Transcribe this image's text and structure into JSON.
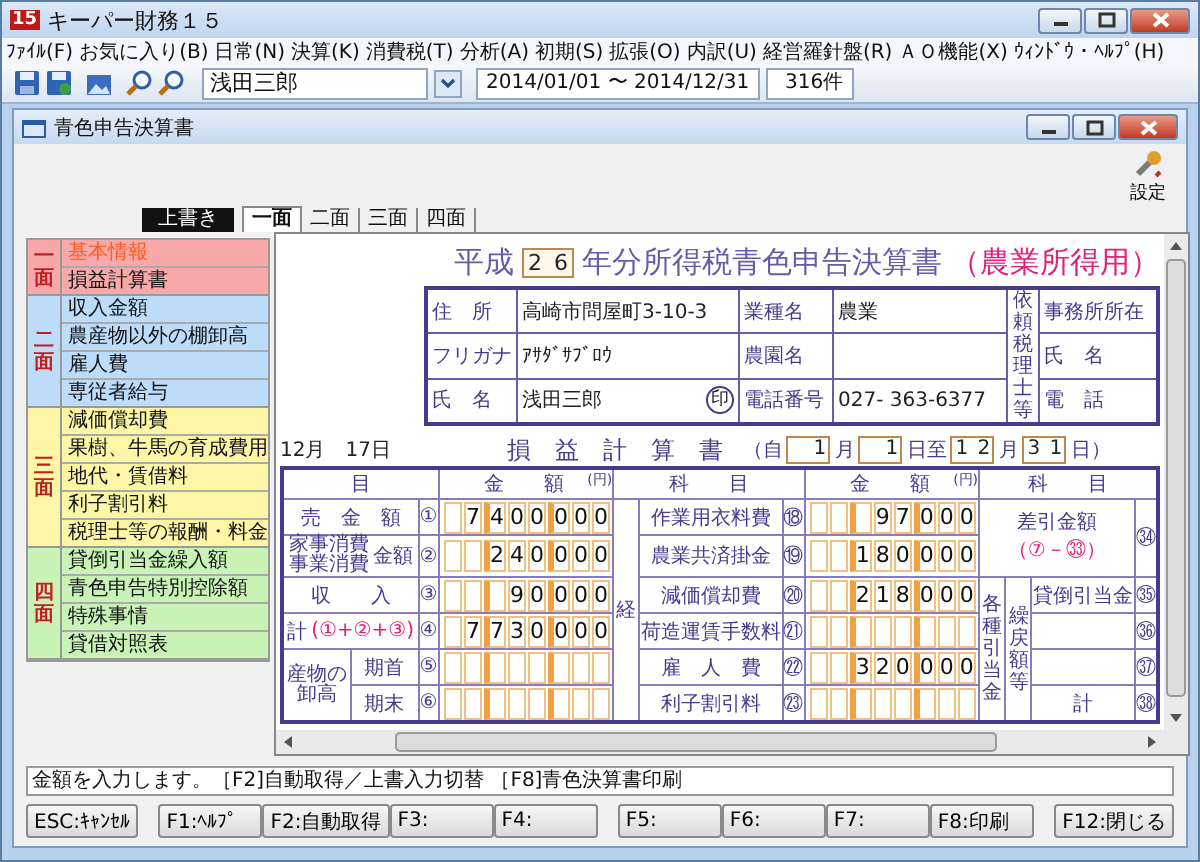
{
  "app": {
    "logo": "15",
    "title": "キーパー財務１５"
  },
  "menu": [
    "ﾌｧｲﾙ(F)",
    "お気に入り(B)",
    "日常(N)",
    "決算(K)",
    "消費税(T)",
    "分析(A)",
    "初期(S)",
    "拡張(O)",
    "内訳(U)",
    "経営羅針盤(R)",
    "ＡＯ機能(X)",
    "ｳｨﾝﾄﾞｳ・ﾍﾙﾌﾟ(H)"
  ],
  "toolbar": {
    "name": "浅田三郎",
    "period": "2014/01/01 〜 2014/12/31",
    "count": "316件"
  },
  "document": {
    "title": "青色申告決算書",
    "settings_label": "設定",
    "mode": "上書き",
    "tabs": [
      {
        "label": "一面",
        "selected": true
      },
      {
        "label": "二面",
        "selected": false
      },
      {
        "label": "三面",
        "selected": false
      },
      {
        "label": "四面",
        "selected": false
      }
    ],
    "nav": [
      {
        "label": "一面",
        "color": "#f7a8a8",
        "items": [
          {
            "label": "基本情報",
            "selected": true
          },
          {
            "label": "損益計算書",
            "selected": false
          }
        ]
      },
      {
        "label": "二面",
        "color": "#bcdcfa",
        "items": [
          {
            "label": "収入金額",
            "selected": false
          },
          {
            "label": "農産物以外の棚卸高",
            "selected": false
          },
          {
            "label": "雇人費",
            "selected": false
          },
          {
            "label": "専従者給与",
            "selected": false
          }
        ]
      },
      {
        "label": "三面",
        "color": "#fdf6a6",
        "items": [
          {
            "label": "減価償却費",
            "selected": false
          },
          {
            "label": "果樹、牛馬の育成費用",
            "selected": false
          },
          {
            "label": "地代・賃借料",
            "selected": false
          },
          {
            "label": "利子割引料",
            "selected": false
          },
          {
            "label": "税理士等の報酬・料金",
            "selected": false
          }
        ]
      },
      {
        "label": "四面",
        "color": "#c8f2b6",
        "items": [
          {
            "label": "貸倒引当金繰入額",
            "selected": false
          },
          {
            "label": "青色申告特別控除額",
            "selected": false
          },
          {
            "label": "特殊事情",
            "selected": false
          },
          {
            "label": "貸借対照表",
            "selected": false
          }
        ]
      }
    ],
    "form": {
      "era": "平成",
      "year": [
        "2",
        "6"
      ],
      "title": "年分所得税青色申告決算書",
      "subtitle": "（農業所得用）",
      "info": {
        "address_label": "住　所",
        "address": "高崎市問屋町3-10-3",
        "kana_label": "フリガナ",
        "kana": "ｱｻﾀﾞｻﾌﾞﾛｳ",
        "name_label": "氏　名",
        "name": "浅田三郎",
        "seal": "印",
        "industry_label": "業種名",
        "industry": "農業",
        "farm_label": "農園名",
        "phone_label": "電話番号",
        "phone": "027- 363-6377",
        "accountant_label": "依頼税理士等",
        "accountant_fields": [
          "事務所所在",
          "氏　名",
          "電　話"
        ]
      },
      "date": "12月　17日",
      "ledger_title": "損　益　計　算　書",
      "period": [
        {
          "kind": "text",
          "text": "（自"
        },
        {
          "kind": "box",
          "digits": [
            "1"
          ]
        },
        {
          "kind": "text",
          "text": "月"
        },
        {
          "kind": "box",
          "digits": [
            "1"
          ]
        },
        {
          "kind": "text",
          "text": "日至"
        },
        {
          "kind": "box",
          "digits": [
            "1",
            "2"
          ]
        },
        {
          "kind": "text",
          "text": "月"
        },
        {
          "kind": "box",
          "digits": [
            "3",
            "1"
          ]
        },
        {
          "kind": "text",
          "text": "日）"
        }
      ],
      "headers": [
        {
          "kind": "item",
          "text": "目"
        },
        {
          "kind": "amount",
          "text": "金　　額",
          "unit": "(円)"
        },
        {
          "kind": "subject",
          "text": "科　　目"
        },
        {
          "kind": "amount",
          "text": "金　　額",
          "unit": "(円)"
        },
        {
          "kind": "subject",
          "text": "科　　目"
        }
      ],
      "left_rows": [
        {
          "kind": "plain",
          "label": "売　金　額",
          "num": "①",
          "amount": [
            "7",
            "4",
            "0",
            "0",
            "0",
            "0",
            "0"
          ]
        },
        {
          "kind": "split",
          "lines": [
            "家事消費",
            "事業消費"
          ],
          "label2": "金額",
          "num": "②",
          "amount": [
            "2",
            "4",
            "0",
            "0",
            "0",
            "0"
          ]
        },
        {
          "kind": "plain",
          "label": "収　　入",
          "num": "③",
          "amount": [
            "9",
            "0",
            "0",
            "0",
            "0"
          ]
        },
        {
          "kind": "total",
          "label": "計",
          "note": "(①+②+③)",
          "num": "④",
          "amount": [
            "7",
            "7",
            "3",
            "0",
            "0",
            "0",
            "0"
          ]
        },
        {
          "kind": "stock",
          "group": [
            "産物の",
            "卸高"
          ],
          "label": "期首",
          "num": "⑤",
          "amount": []
        },
        {
          "kind": "stock_end",
          "label": "期末",
          "num": "⑥",
          "amount": []
        }
      ],
      "expense_label": "経",
      "mid_rows": [
        {
          "label": "作業用衣料費",
          "num": "⑱",
          "amount": [
            "9",
            "7",
            "0",
            "0",
            "0"
          ]
        },
        {
          "label": "農業共済掛金",
          "num": "⑲",
          "amount": [
            "1",
            "8",
            "0",
            "0",
            "0",
            "0"
          ]
        },
        {
          "label": "減価償却費",
          "num": "⑳",
          "amount": [
            "2",
            "1",
            "8",
            "0",
            "0",
            "0"
          ]
        },
        {
          "label": "荷造運賃手数料",
          "num": "㉑",
          "amount": []
        },
        {
          "label": "雇　人　費",
          "num": "㉒",
          "amount": [
            "3",
            "2",
            "0",
            "0",
            "0",
            "0"
          ]
        },
        {
          "label": "利子割引料",
          "num": "㉓",
          "amount": []
        }
      ],
      "balance": {
        "label": "差引金額",
        "note": "（⑦－㉝）",
        "num": "㉞"
      },
      "reserve_label": "各種引当金",
      "reversal_label": "繰戻額等",
      "reserve_rows": [
        {
          "label": "貸倒引当金",
          "num": "㉟"
        },
        {
          "label": "",
          "num": "㊱"
        },
        {
          "label": "",
          "num": "㊲"
        },
        {
          "label": "計",
          "num": "㊳"
        }
      ]
    },
    "status": "金額を入力します。［F2]自動取得／上書入力切替 ［F8]青色決算書印刷",
    "fkeys": [
      [
        "ESC:ｷｬﾝｾﾙ"
      ],
      [
        "F1:ﾍﾙﾌﾟ",
        "F2:自動取得",
        "F3:",
        "F4:"
      ],
      [
        "F5:",
        "F6:",
        "F7:",
        "F8:印刷"
      ],
      [
        "F12:閉じる"
      ]
    ]
  }
}
